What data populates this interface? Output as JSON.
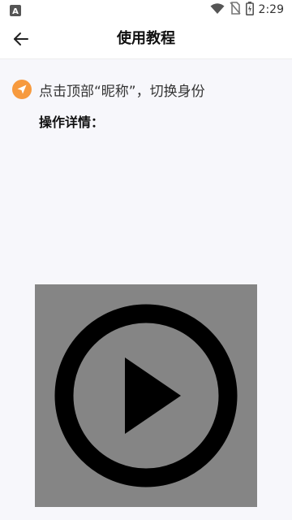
{
  "status_bar": {
    "time": "2:29",
    "icons": [
      "app-notification-icon",
      "wifi-icon",
      "no-sim-icon",
      "battery-icon"
    ]
  },
  "header": {
    "title": "使用教程",
    "back_icon": "back-arrow-icon"
  },
  "step": {
    "icon": "send-icon",
    "text": "点击顶部“昵称”，切换身份"
  },
  "details": {
    "label": "操作详情："
  },
  "video": {
    "icon": "play-circle-icon"
  },
  "colors": {
    "accent": "#F79A3E",
    "background": "#F7F7FB",
    "video_bg": "#858585"
  }
}
